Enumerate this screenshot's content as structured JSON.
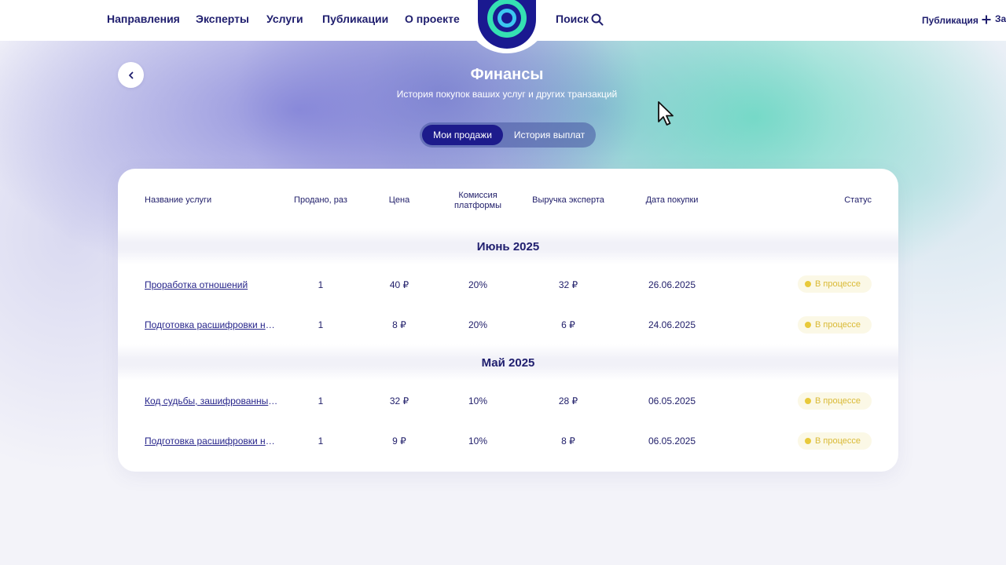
{
  "header": {
    "nav": [
      "Направления",
      "Эксперты",
      "Услуги",
      "Публикации",
      "О проекте"
    ],
    "search_label": "Поиск",
    "publish_label": "Публикация",
    "clipped_label": "За"
  },
  "page": {
    "title": "Финансы",
    "subtitle": "История покупок ваших услуг и других транзакций"
  },
  "tabs": {
    "active": "Мои продажи",
    "inactive": "История выплат"
  },
  "table": {
    "headers": {
      "name": "Название услуги",
      "sold": "Продано, раз",
      "price": "Цена",
      "commission_1": "Комиссия",
      "commission_2": "платформы",
      "revenue": "Выручка эксперта",
      "date": "Дата покупки",
      "status": "Статус"
    },
    "groups": [
      {
        "month": "Июнь 2025",
        "rows": [
          {
            "name": "Проработка отношений",
            "sold": "1",
            "price": "40 ₽",
            "commission": "20%",
            "revenue": "32 ₽",
            "date": "26.06.2025",
            "status": "В процессе"
          },
          {
            "name": "Подготовка расшифровки на…",
            "sold": "1",
            "price": "8 ₽",
            "commission": "20%",
            "revenue": "6 ₽",
            "date": "24.06.2025",
            "status": "В процессе"
          }
        ]
      },
      {
        "month": "Май 2025",
        "rows": [
          {
            "name": "Код судьбы, зашифрованный…",
            "sold": "1",
            "price": "32 ₽",
            "commission": "10%",
            "revenue": "28 ₽",
            "date": "06.05.2025",
            "status": "В процессе"
          },
          {
            "name": "Подготовка расшифровки на…",
            "sold": "1",
            "price": "9 ₽",
            "commission": "10%",
            "revenue": "8 ₽",
            "date": "06.05.2025",
            "status": "В процессе"
          }
        ]
      }
    ]
  },
  "colors": {
    "brand_dark": "#1d1b8c",
    "accent_teal": "#35e0b2",
    "status_pending": "#e8c93a"
  }
}
